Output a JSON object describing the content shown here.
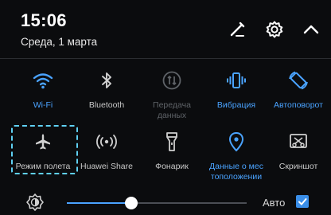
{
  "status": {
    "time": "15:06",
    "date": "Среда, 1 марта"
  },
  "header_icons": [
    "edit-icon",
    "settings-gear-icon",
    "chevron-up-icon"
  ],
  "toggles": [
    {
      "label": "Wi-Fi",
      "state": "on",
      "icon": "wifi-icon"
    },
    {
      "label": "Bluetooth",
      "state": "off",
      "icon": "bluetooth-icon"
    },
    {
      "label": "Передача\nданных",
      "state": "disabled",
      "icon": "mobile-data-icon"
    },
    {
      "label": "Вибрация",
      "state": "on",
      "icon": "vibration-icon"
    },
    {
      "label": "Автоповорот",
      "state": "on",
      "icon": "auto-rotate-icon"
    },
    {
      "label": "Режим полета",
      "state": "off",
      "icon": "airplane-icon"
    },
    {
      "label": "Huawei Share",
      "state": "off",
      "icon": "huawei-share-icon"
    },
    {
      "label": "Фонарик",
      "state": "off",
      "icon": "flashlight-icon"
    },
    {
      "label": "Данные о мес\nтоположении",
      "state": "on",
      "icon": "location-pin-icon"
    },
    {
      "label": "Скриншот",
      "state": "off",
      "icon": "screenshot-icon"
    }
  ],
  "brightness": {
    "level": 0.36,
    "auto_label": "Авто",
    "auto_checked": true
  },
  "colors": {
    "background": "#0b0c0e",
    "accent": "#4aa3ff",
    "highlight": "#5fd0f2"
  }
}
